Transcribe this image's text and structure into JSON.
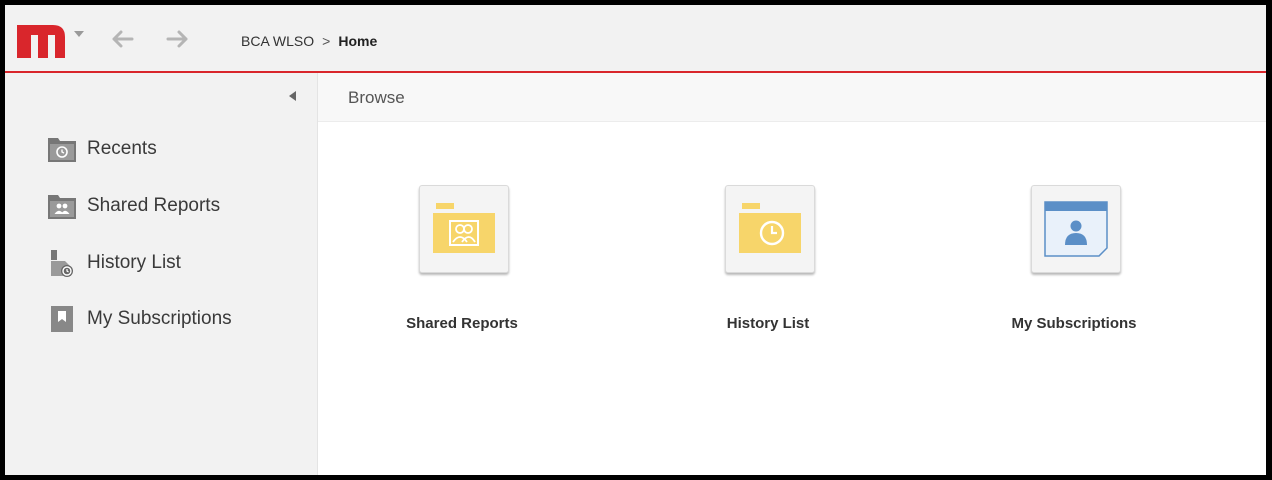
{
  "colors": {
    "accent": "#d9262c",
    "folder_yellow": "#f7d56a",
    "subscription_blue": "#5b8fc7"
  },
  "header": {
    "logo_icon": "microstrategy-logo-icon",
    "back_icon": "arrow-left-icon",
    "forward_icon": "arrow-right-icon",
    "breadcrumb": {
      "project": "BCA WLSO",
      "separator": ">",
      "current": "Home"
    }
  },
  "sidebar": {
    "collapse_icon": "triangle-left-icon",
    "items": [
      {
        "label": "Recents",
        "icon": "recents-folder-icon"
      },
      {
        "label": "Shared Reports",
        "icon": "shared-folder-icon"
      },
      {
        "label": "History List",
        "icon": "history-list-icon"
      },
      {
        "label": "My Subscriptions",
        "icon": "bookmark-icon"
      }
    ]
  },
  "main": {
    "title": "Browse",
    "tiles": [
      {
        "label": "Shared Reports",
        "icon": "shared-reports-folder-icon"
      },
      {
        "label": "History List",
        "icon": "history-folder-icon"
      },
      {
        "label": "My Subscriptions",
        "icon": "subscriptions-user-icon"
      }
    ]
  }
}
